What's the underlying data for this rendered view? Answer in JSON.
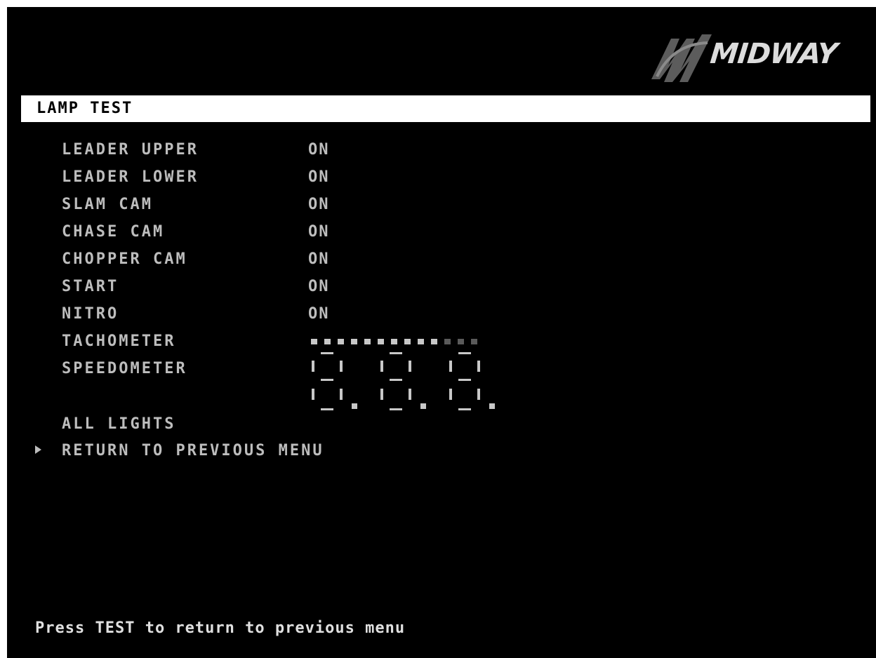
{
  "brand": {
    "logo_text": "MIDWAY"
  },
  "header": {
    "title": "LAMP TEST"
  },
  "menu": {
    "items": [
      {
        "label": "LEADER UPPER",
        "value": "ON"
      },
      {
        "label": "LEADER LOWER",
        "value": "ON"
      },
      {
        "label": "SLAM CAM",
        "value": "ON"
      },
      {
        "label": "CHASE CAM",
        "value": "ON"
      },
      {
        "label": "CHOPPER CAM",
        "value": "ON"
      },
      {
        "label": "START",
        "value": "ON"
      },
      {
        "label": "NITRO",
        "value": "ON"
      },
      {
        "label": "TACHOMETER",
        "value": ""
      },
      {
        "label": "SPEEDOMETER",
        "value": ""
      },
      {
        "label": "ALL LIGHTS",
        "value": ""
      },
      {
        "label": "RETURN TO PREVIOUS MENU",
        "value": ""
      }
    ],
    "selected_item": "RETURN TO PREVIOUS MENU"
  },
  "tachometer": {
    "segments_total": 13,
    "segments_lit": 10
  },
  "speedometer": {
    "digits": 3,
    "display": "8.8.8."
  },
  "footer": {
    "hint": "Press TEST to return to previous menu"
  },
  "colors": {
    "background": "#000000",
    "title_bar": "#ffffff",
    "menu_text": "#bdbdbd",
    "segment_lit": "#c8c8c8",
    "segment_dim": "#5a5a5a"
  },
  "icons": {
    "cursor": "triangle-right",
    "logo": "midway-logo"
  }
}
